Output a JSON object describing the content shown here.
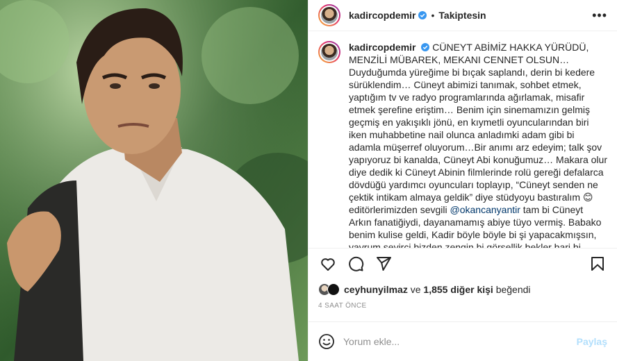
{
  "post": {
    "username": "kadircopdemir",
    "follow_status": "Takiptesin",
    "caption_body": "CÜNEYT ABİMİZ HAKKA YÜRÜDÜ, MENZİLİ MÜBAREK, MEKANI CENNET OLSUN… Duyduğumda yüreğime bi bıçak saplandı, derin bi kedere sürüklendim… Cüneyt abimizi tanımak, sohbet etmek, yaptığım tv ve radyo programlarında ağırlamak, misafir etmek şerefine eriştim… Benim için sinemamızın gelmiş geçmiş en yakışıklı jönü, en kıymetli oyuncularından biri iken muhabbetine nail olunca anladımki adam gibi bi adamla müşerref oluyorum…Bir anımı arz edeyim; talk şov yapıyoruz bi kanalda, Cüneyt Abi konuğumuz… Makara olur diye dedik ki Cüneyt Abinin filmlerinde rolü gereği defalarca dövdüğü yardımcı oyuncuları toplayıp, “Cüneyt senden ne çektik intikam almaya geldik” diye stüdyoyu bastıralım 😊 editörlerimizden sevgili",
    "mention": "@okancanyantir",
    "caption_tail": "tam bi Cüneyt Arkın fanatiğiydi, dayanamamış abiye tüyo vermiş. Babako benim kulise geldi, Kadir böyle böyle bi şi yapacakmışsın, yavrum seyirci bizden zengin bi görsellik bekler bari bi döğüş kareografisi yapalım da millet zevkle seyretsin dedi…üşenmedi, gocunmadı o yardımcı oyuncu arkadaşlara oyun verdi, prova yaptırdı sonucta yayında",
    "likes_user": "ceyhunyilmaz",
    "likes_connector": "ve",
    "likes_others": "1,855 diğer kişi",
    "likes_suffix": "beğendi",
    "timestamp": "4 SAAT ÖNCE",
    "comment_placeholder": "Yorum ekle...",
    "share_label": "Paylaş"
  },
  "icons": {
    "verified": "verified-badge-icon",
    "more": "more-options-icon",
    "like": "heart-icon",
    "comment": "comment-bubble-icon",
    "share": "paper-plane-icon",
    "save": "bookmark-icon",
    "emoji": "emoji-smiley-icon"
  },
  "colors": {
    "verified_blue": "#3897f0",
    "link_blue": "#00376b",
    "share_disabled": "#b2dffc",
    "muted": "#8e8e8e"
  }
}
